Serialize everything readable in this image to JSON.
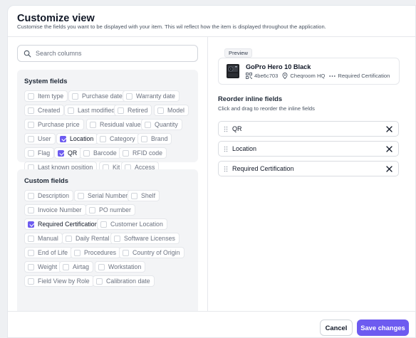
{
  "dialog": {
    "title": "Customize view",
    "subtitle": "Customise the fields you want to be displayed with your item. This wil reflect how the item is displayed throughout the application."
  },
  "search": {
    "placeholder": "Search columns",
    "value": ""
  },
  "system_fields": {
    "title": "System fields",
    "items": [
      {
        "label": "Item type",
        "checked": false
      },
      {
        "label": "Purchase date",
        "checked": false
      },
      {
        "label": "Warranty date",
        "checked": false
      },
      {
        "label": "Created",
        "checked": false
      },
      {
        "label": "Last modified",
        "checked": false
      },
      {
        "label": "Retired",
        "checked": false
      },
      {
        "label": "Model",
        "checked": false
      },
      {
        "label": "Purchase price",
        "checked": false
      },
      {
        "label": "Residual value",
        "checked": false
      },
      {
        "label": "Quantity",
        "checked": false
      },
      {
        "label": "User",
        "checked": false
      },
      {
        "label": "Location",
        "checked": true
      },
      {
        "label": "Category",
        "checked": false
      },
      {
        "label": "Brand",
        "checked": false
      },
      {
        "label": "Flag",
        "checked": false
      },
      {
        "label": "QR",
        "checked": true
      },
      {
        "label": "Barcode",
        "checked": false
      },
      {
        "label": "RFID code",
        "checked": false
      },
      {
        "label": "Last known position",
        "checked": false
      },
      {
        "label": "Kit",
        "checked": false
      },
      {
        "label": "Access",
        "checked": false
      }
    ]
  },
  "custom_fields": {
    "title": "Custom fields",
    "items": [
      {
        "label": "Description",
        "checked": false
      },
      {
        "label": "Serial Number",
        "checked": false
      },
      {
        "label": "Shelf",
        "checked": false
      },
      {
        "label": "Invoice Number",
        "checked": false
      },
      {
        "label": "PO number",
        "checked": false
      },
      {
        "label": "Required Certification",
        "checked": true
      },
      {
        "label": "Customer Location",
        "checked": false
      },
      {
        "label": "Manual",
        "checked": false
      },
      {
        "label": "Daily Rental",
        "checked": false
      },
      {
        "label": "Software Licenses",
        "checked": false
      },
      {
        "label": "End of Life",
        "checked": false
      },
      {
        "label": "Procedures",
        "checked": false
      },
      {
        "label": "Country of Origin",
        "checked": false
      },
      {
        "label": "Weight",
        "checked": false
      },
      {
        "label": "Airtag",
        "checked": false
      },
      {
        "label": "Workstation",
        "checked": false
      },
      {
        "label": "Field View by Role",
        "checked": false
      },
      {
        "label": "Calibration date",
        "checked": false
      }
    ]
  },
  "preview": {
    "tag": "Preview",
    "item_name": "GoPro Hero 10 Black",
    "qr_code": "4be6c703",
    "location": "Cheqroom HQ",
    "certification": "Required Certification"
  },
  "reorder": {
    "title": "Reorder inline fields",
    "subtitle": "Click and drag to reorder the inline fields",
    "items": [
      "QR",
      "Location",
      "Required Certification"
    ]
  },
  "footer": {
    "cancel_label": "Cancel",
    "save_label": "Save changes"
  },
  "colors": {
    "accent": "#6d5bf0",
    "panel_bg": "#f3f4f6"
  }
}
